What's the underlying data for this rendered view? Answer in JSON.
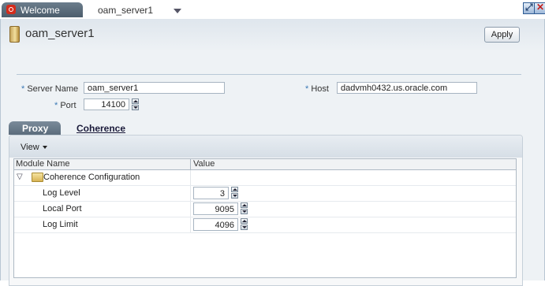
{
  "tabs": {
    "welcome": "Welcome",
    "server": "oam_server1"
  },
  "page": {
    "title": "oam_server1",
    "apply_label": "Apply"
  },
  "form": {
    "server_name_label": "Server Name",
    "server_name_value": "oam_server1",
    "host_label": "Host",
    "host_value": "dadvmh0432.us.oracle.com",
    "port_label": "Port",
    "port_value": "14100",
    "required_marker": "*"
  },
  "subtabs": {
    "proxy": "Proxy",
    "coherence": "Coherence"
  },
  "toolbar": {
    "view_label": "View"
  },
  "table": {
    "columns": [
      "Module Name",
      "Value"
    ],
    "group": {
      "toggle": "▽",
      "label": "Coherence Configuration"
    },
    "rows": [
      {
        "label": "Log Level",
        "value": "3"
      },
      {
        "label": "Local Port",
        "value": "9095"
      },
      {
        "label": "Log Limit",
        "value": "4096"
      }
    ]
  },
  "icons": [
    "oracle-logo-icon",
    "tab-menu-icon",
    "maximize-icon",
    "close-icon",
    "page-icon",
    "folder-icon",
    "spinner-icon"
  ],
  "colors": {
    "tab_active": "#5b6c7c",
    "required": "#3a79b5",
    "frame_bg": "#eef2f5"
  }
}
